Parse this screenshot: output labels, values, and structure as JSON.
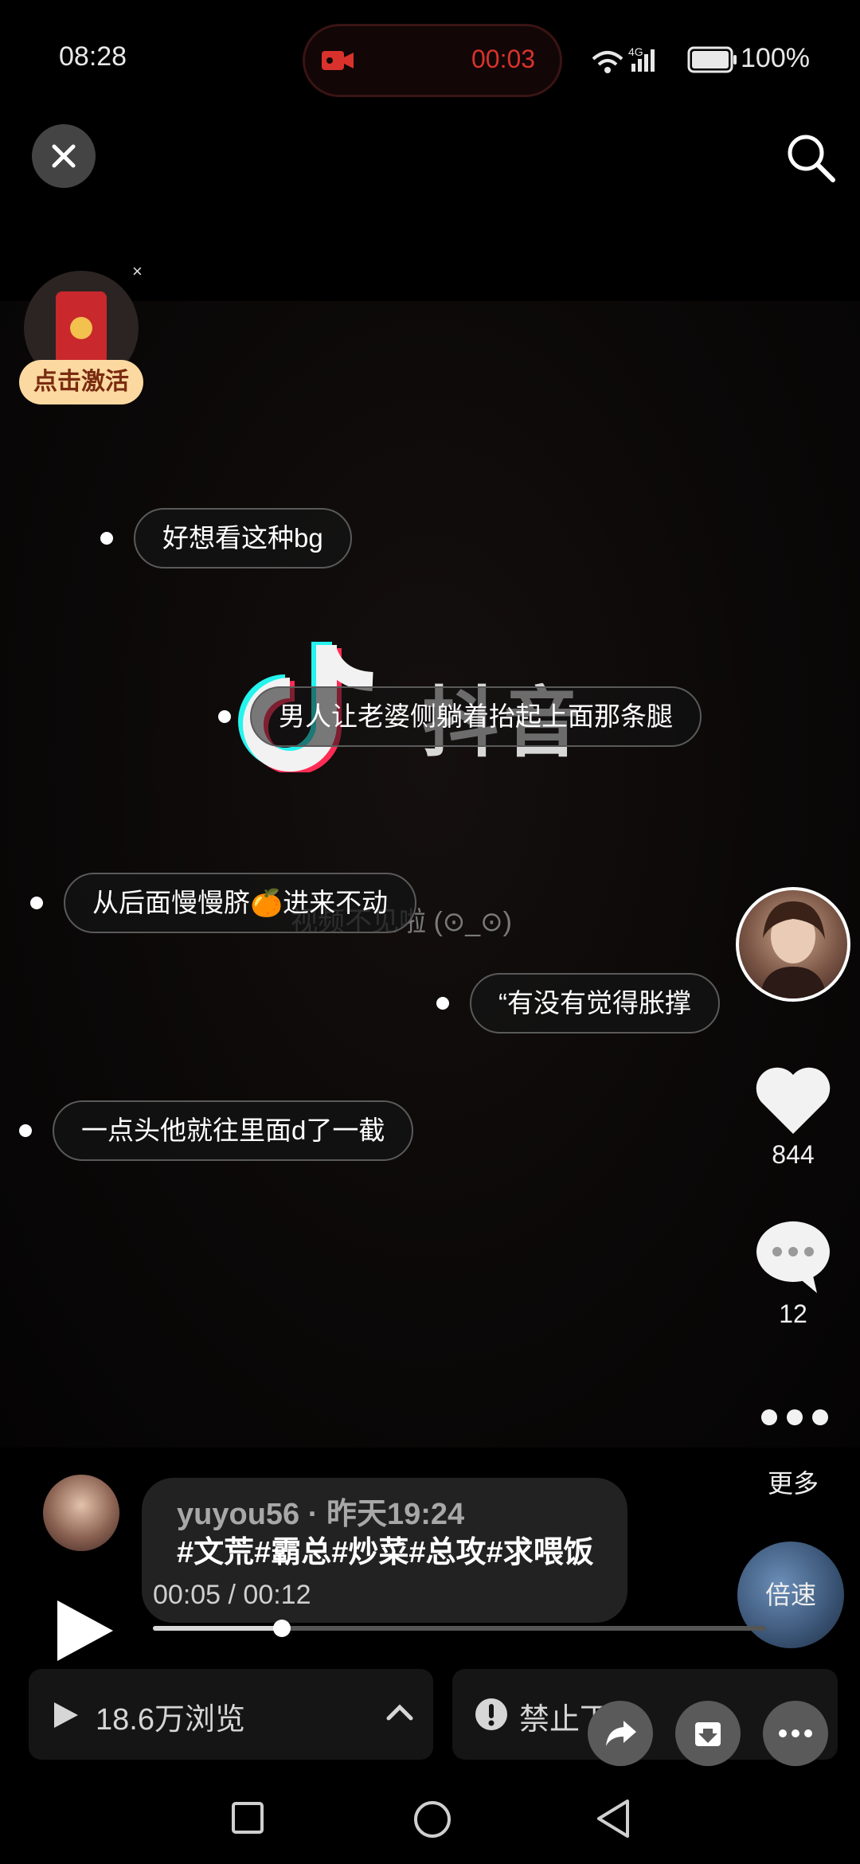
{
  "status_bar": {
    "time": "08:28",
    "recording_time": "00:03",
    "battery": "100%",
    "network": "4G"
  },
  "top": {
    "close_icon": "close-icon",
    "search_icon": "search-icon"
  },
  "redpacket": {
    "label": "点击激活",
    "close": "×"
  },
  "watermark": {
    "logo_text": "抖音",
    "subtitle": "视频不见啦 (⊙_⊙)"
  },
  "danmaku": [
    {
      "text": "好想看这种bg"
    },
    {
      "text": "男人让老婆侧躺着抬起上面那条腿"
    },
    {
      "text": "从后面慢慢脐🍊进来不动"
    },
    {
      "text": "“有没有觉得胀撑"
    },
    {
      "text": "一点头他就往里面d了一截"
    }
  ],
  "actions": {
    "like_count": "844",
    "comment_count": "12",
    "more_label": "更多"
  },
  "post": {
    "username": "yuyou56 · 昨天19:24",
    "description": "#文荒#霸总#炒菜#总攻#求喂饭",
    "speed_label": "倍速"
  },
  "player": {
    "time_display": "00:05 / 00:12",
    "progress": 0.21
  },
  "bottom": {
    "views": "18.6万浏览",
    "forbid": "禁止下载"
  },
  "colors": {
    "record_red": "#d9322c",
    "redpacket_bg": "#fbd9a0"
  }
}
